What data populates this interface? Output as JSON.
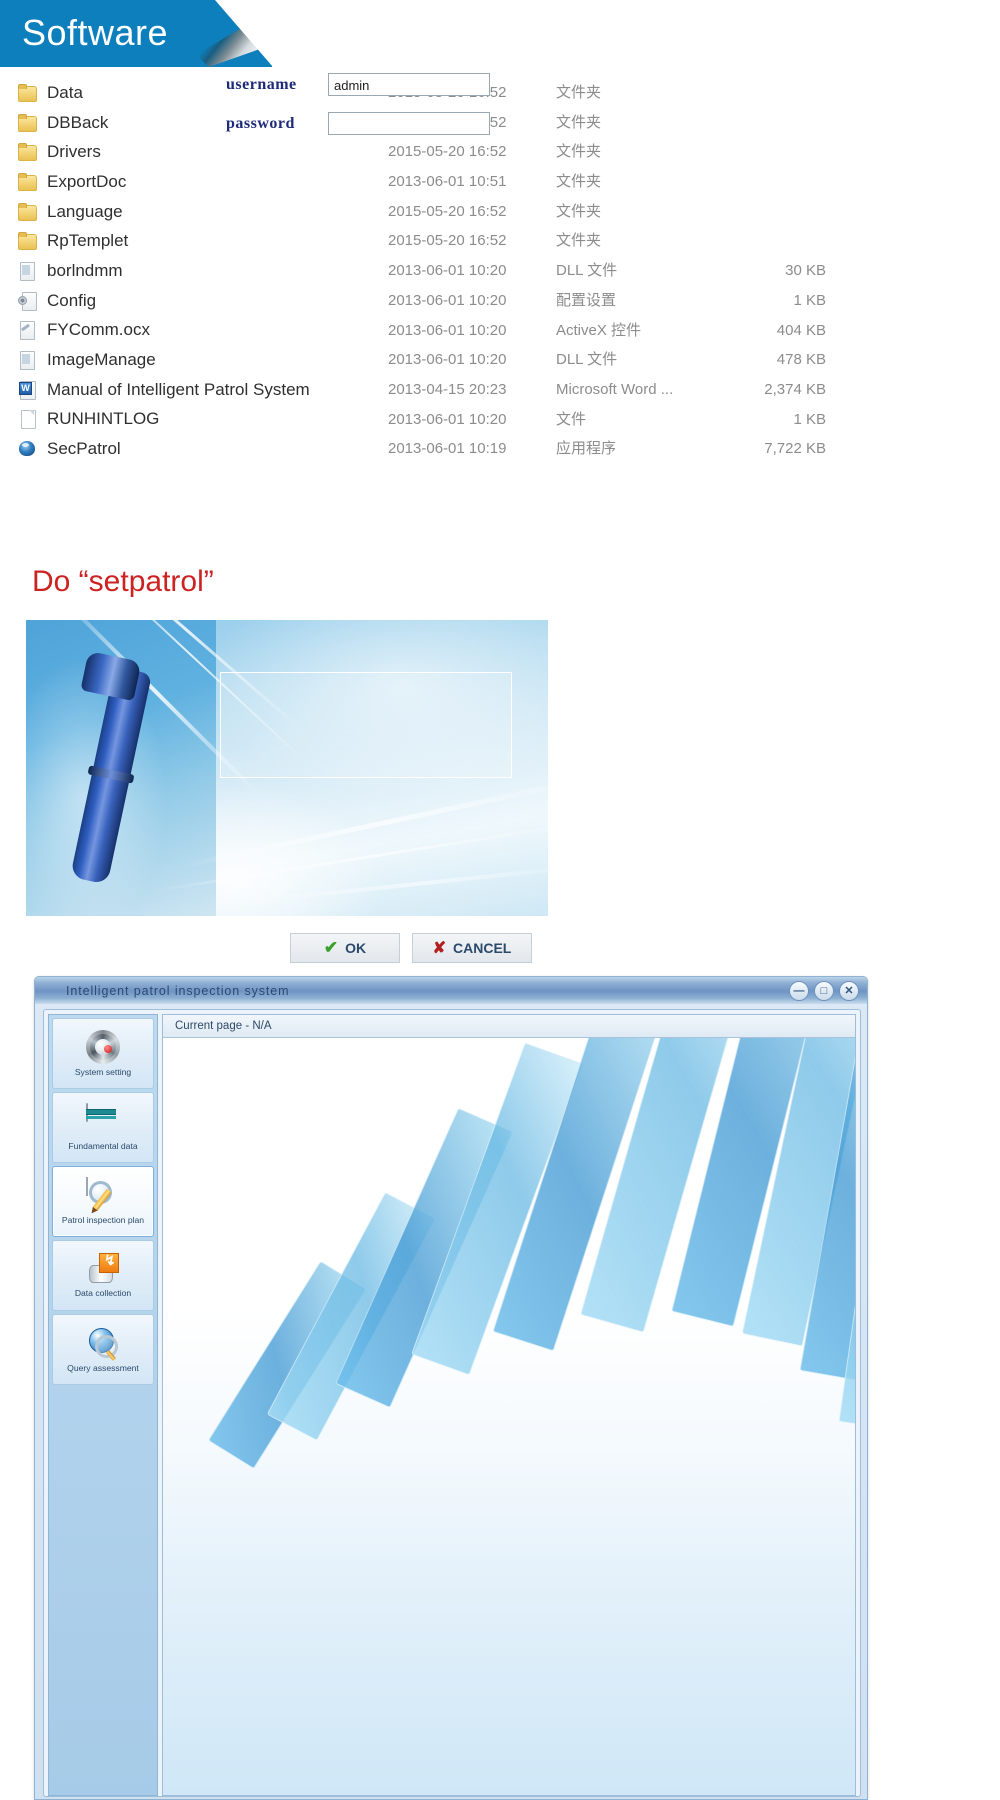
{
  "banner": {
    "title": "Software"
  },
  "file_list": {
    "rows": [
      {
        "name": "Data",
        "icon": "folder-icon",
        "date": "2015-05-20 16:52",
        "type": "文件夹",
        "size": ""
      },
      {
        "name": "DBBack",
        "icon": "folder-icon",
        "date": "2015-05-20 16:52",
        "type": "文件夹",
        "size": ""
      },
      {
        "name": "Drivers",
        "icon": "folder-icon",
        "date": "2015-05-20 16:52",
        "type": "文件夹",
        "size": ""
      },
      {
        "name": "ExportDoc",
        "icon": "folder-icon",
        "date": "2013-06-01 10:51",
        "type": "文件夹",
        "size": ""
      },
      {
        "name": "Language",
        "icon": "folder-icon",
        "date": "2015-05-20 16:52",
        "type": "文件夹",
        "size": ""
      },
      {
        "name": "RpTemplet",
        "icon": "folder-icon",
        "date": "2015-05-20 16:52",
        "type": "文件夹",
        "size": ""
      },
      {
        "name": "borlndmm",
        "icon": "dll-file-icon",
        "date": "2013-06-01 10:20",
        "type": "DLL 文件",
        "size": "30 KB"
      },
      {
        "name": "Config",
        "icon": "gear-file-icon",
        "date": "2013-06-01 10:20",
        "type": "配置设置",
        "size": "1 KB"
      },
      {
        "name": "FYComm.ocx",
        "icon": "ocx-file-icon",
        "date": "2013-06-01 10:20",
        "type": "ActiveX 控件",
        "size": "404 KB"
      },
      {
        "name": "ImageManage",
        "icon": "dll-file-icon",
        "date": "2013-06-01 10:20",
        "type": "DLL 文件",
        "size": "478 KB"
      },
      {
        "name": "Manual of Intelligent Patrol System",
        "icon": "word-file-icon",
        "date": "2013-04-15 20:23",
        "type": "Microsoft Word ...",
        "size": "2,374 KB"
      },
      {
        "name": "RUNHINTLOG",
        "icon": "plain-file-icon",
        "date": "2013-06-01 10:20",
        "type": "文件",
        "size": "1 KB"
      },
      {
        "name": "SecPatrol",
        "icon": "application-icon",
        "date": "2013-06-01 10:19",
        "type": "应用程序",
        "size": "7,722 KB"
      }
    ]
  },
  "instruction": {
    "text": "Do “setpatrol”",
    "color": "#cc2222"
  },
  "login_dialog": {
    "username_label": "username",
    "password_label": "password",
    "username_value": "admin",
    "password_value": "",
    "ok_label": "OK",
    "cancel_label": "CANCEL"
  },
  "app_window": {
    "title": "Intelligent patrol inspection system",
    "window_buttons": {
      "minimize": "—",
      "maximize": "□",
      "close": "✕"
    },
    "page_tab": "Current page - N/A",
    "sidebar": {
      "items": [
        {
          "label": "System setting",
          "icon": "gear-icon",
          "active": false
        },
        {
          "label": "Fundamental data",
          "icon": "database-icon",
          "active": false
        },
        {
          "label": "Patrol inspection plan",
          "icon": "plan-magnifier-icon",
          "active": true
        },
        {
          "label": "Data collection",
          "icon": "data-transfer-icon",
          "active": false
        },
        {
          "label": "Query assessment",
          "icon": "globe-magnifier-icon",
          "active": false
        }
      ]
    }
  },
  "colors": {
    "banner_blue": "#0d7fbc",
    "instruction_red": "#cc2222",
    "titlebar_blue": "#6f93c4",
    "accent_cyan": "#4fa3d8"
  }
}
